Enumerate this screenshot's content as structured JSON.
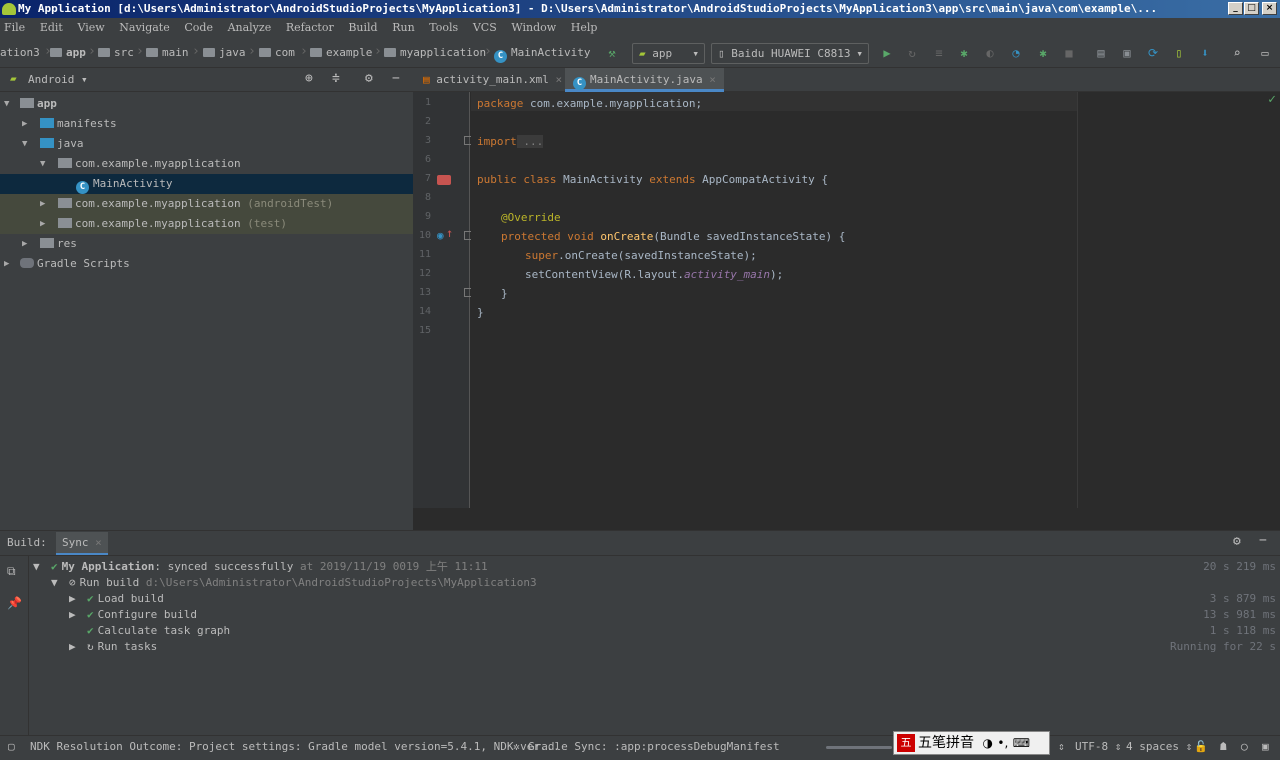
{
  "window": {
    "title": "My Application [d:\\Users\\Administrator\\AndroidStudioProjects\\MyApplication3] - D:\\Users\\Administrator\\AndroidStudioProjects\\MyApplication3\\app\\src\\main\\java\\com\\example\\..."
  },
  "menu": [
    "File",
    "Edit",
    "View",
    "Navigate",
    "Code",
    "Analyze",
    "Refactor",
    "Build",
    "Run",
    "Tools",
    "VCS",
    "Window",
    "Help"
  ],
  "breadcrumb": [
    "ation3",
    "app",
    "src",
    "main",
    "java",
    "com",
    "example",
    "myapplication",
    "MainActivity"
  ],
  "toolbar": {
    "config": "app",
    "device": "Baidu HUAWEI C8813"
  },
  "project": {
    "view": "Android",
    "tree": [
      {
        "label": "app"
      },
      {
        "label": "manifests"
      },
      {
        "label": "java"
      },
      {
        "label": "com.example.myapplication"
      },
      {
        "label": "MainActivity"
      },
      {
        "label": "com.example.myapplication",
        "suffix": "(androidTest)"
      },
      {
        "label": "com.example.myapplication",
        "suffix": "(test)"
      },
      {
        "label": "res"
      },
      {
        "label": "Gradle Scripts"
      }
    ]
  },
  "editor": {
    "tabs": [
      "activity_main.xml",
      "MainActivity.java"
    ],
    "line_numbers": [
      "1",
      "2",
      "3",
      "6",
      "7",
      "8",
      "9",
      "10",
      "11",
      "12",
      "13",
      "14",
      "15"
    ],
    "code": {
      "l1_kw": "package",
      "l1_rest": " com.example.myapplication;",
      "l3_kw": "import",
      "l3_fold": " ...",
      "l7_kw": "public class",
      "l7_name": " MainActivity ",
      "l7_kw2": "extends",
      "l7_rest": " AppCompatActivity {",
      "l9_ann": "@Override",
      "l10_kw": "protected void",
      "l10_fn": " onCreate",
      "l10_rest": "(Bundle savedInstanceState) {",
      "l11_kw": "super",
      "l11_rest": ".onCreate(savedInstanceState);",
      "l12_rest": "setContentView(R.layout.",
      "l12_it": "activity_main",
      "l12_end": ");",
      "l13": "}",
      "l14": "}"
    }
  },
  "build": {
    "tabs": [
      "Build:",
      "Sync"
    ],
    "rows": [
      {
        "bold": "My Application",
        "text": ": synced successfully ",
        "dim": "at 2019/11/19 0019 上午 11:11",
        "time": "20 s 219 ms"
      },
      {
        "text": "Run build ",
        "dim": "d:\\Users\\Administrator\\AndroidStudioProjects\\MyApplication3",
        "time": ""
      },
      {
        "text": "Load build",
        "time": "3 s 879 ms"
      },
      {
        "text": "Configure build",
        "time": "13 s 981 ms"
      },
      {
        "text": "Calculate task graph",
        "time": "1 s 118 ms"
      },
      {
        "text": "Run tasks",
        "time": "Running for 22 s"
      }
    ]
  },
  "status": {
    "message": "NDK Resolution Outcome: Project settings: Gradle model version=5.4.1, NDK ver...",
    "sync": "Gradle Sync: :app:processDebugManifest",
    "encoding": "UTF-8",
    "indent": "4 spaces",
    "ime": "五笔拼音"
  },
  "colors": {
    "accent": "#4a88c7",
    "success": "#59a869",
    "run": "#59a869"
  }
}
